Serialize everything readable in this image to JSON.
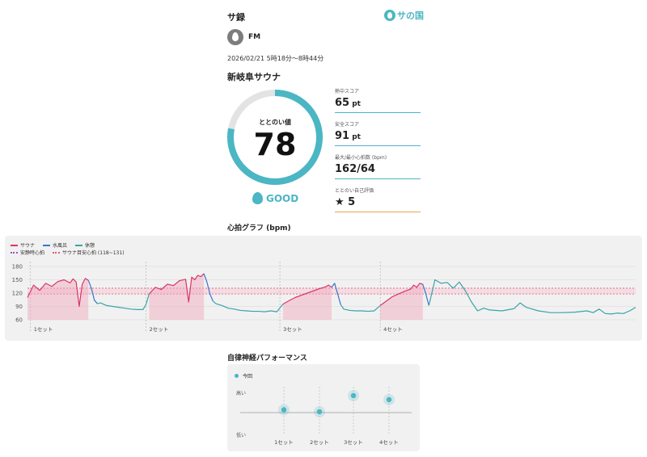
{
  "header": {
    "title": "サ録",
    "brand": "サの国"
  },
  "user": {
    "name": "FM",
    "icon": "drop-avatar-icon"
  },
  "session": {
    "datetime": "2026/02/21 5時18分〜8時44分",
    "facility": "新岐阜サウナ"
  },
  "score": {
    "label": "ととのい値",
    "value": "78",
    "max": 100,
    "grade": "GOOD",
    "grade_icon": "drop-icon"
  },
  "stats": [
    {
      "label": "熱中スコア",
      "value": "65",
      "unit": " pt"
    },
    {
      "label": "安全スコア",
      "value": "91",
      "unit": " pt"
    },
    {
      "label": "最大/最小心拍数 (bpm)",
      "value": "162/64",
      "unit": ""
    },
    {
      "label": "ととのい自己評価",
      "value": "★ 5",
      "unit": ""
    }
  ],
  "colors": {
    "accent": "#4bb6c4",
    "sauna": "#d9366b",
    "water": "#3b74c9",
    "rest": "#3aa3a8",
    "resting_line": "#9b4fd0",
    "target_band": "#e8577a",
    "self_eval_line": "#e8a74c"
  },
  "heart_chart": {
    "title": "心拍グラフ (bpm)",
    "legend": [
      {
        "label": "サウナ",
        "color": "#d9366b",
        "style": "solid"
      },
      {
        "label": "水風呂",
        "color": "#3b74c9",
        "style": "solid"
      },
      {
        "label": "休憩",
        "color": "#3aa3a8",
        "style": "solid"
      },
      {
        "label": "安静時心拍",
        "color": "#9b4fd0",
        "style": "dotted"
      },
      {
        "label": "サウナ目安心拍 (118~131)",
        "color": "#e8577a",
        "style": "dotted"
      }
    ],
    "sets": [
      "1セット",
      "2セット",
      "3セット",
      "4セット"
    ]
  },
  "chart_data": {
    "type": "line",
    "ylim": [
      60,
      180
    ],
    "yticks": [
      180,
      150,
      120,
      90,
      60
    ],
    "xlim": [
      0,
      100
    ],
    "target_range": [
      118,
      131
    ],
    "resting": 124,
    "set_markers": [
      {
        "label": "1セット",
        "x": 0.5
      },
      {
        "label": "2セット",
        "x": 19.5
      },
      {
        "label": "3セット",
        "x": 41.5
      },
      {
        "label": "4セット",
        "x": 58
      }
    ],
    "series": [
      {
        "name": "サウナ",
        "color": "#d9366b",
        "segments": [
          [
            [
              0,
              110
            ],
            [
              1,
              138
            ],
            [
              2,
              126
            ],
            [
              3,
              142
            ],
            [
              4,
              135
            ],
            [
              5,
              146
            ],
            [
              6,
              150
            ],
            [
              7,
              143
            ],
            [
              7.5,
              152
            ],
            [
              8,
              145
            ],
            [
              8.5,
              90
            ],
            [
              9,
              140
            ],
            [
              9.5,
              153
            ],
            [
              10,
              149
            ]
          ],
          [
            [
              20,
              118
            ],
            [
              21,
              133
            ],
            [
              22,
              128
            ],
            [
              23,
              140
            ],
            [
              24,
              137
            ],
            [
              25,
              148
            ],
            [
              26,
              151
            ],
            [
              26.5,
              100
            ],
            [
              27,
              156
            ],
            [
              27.5,
              150
            ],
            [
              28,
              160
            ],
            [
              28.5,
              157
            ],
            [
              29,
              164
            ]
          ],
          [
            [
              42,
              95
            ],
            [
              43,
              103
            ],
            [
              44,
              110
            ],
            [
              45,
              115
            ],
            [
              46,
              120
            ],
            [
              47,
              125
            ],
            [
              48,
              130
            ],
            [
              49,
              134
            ],
            [
              49.5,
              138
            ],
            [
              50,
              133
            ]
          ],
          [
            [
              58,
              92
            ],
            [
              59,
              102
            ],
            [
              60,
              112
            ],
            [
              61,
              118
            ],
            [
              62,
              124
            ],
            [
              63,
              129
            ],
            [
              63.5,
              138
            ],
            [
              64,
              133
            ],
            [
              64.5,
              142
            ],
            [
              65,
              140
            ]
          ]
        ]
      },
      {
        "name": "水風呂",
        "color": "#3b74c9",
        "segments": [
          [
            [
              10,
              149
            ],
            [
              10.5,
              131
            ],
            [
              11,
              104
            ],
            [
              11.5,
              96
            ]
          ],
          [
            [
              29,
              164
            ],
            [
              29.5,
              145
            ],
            [
              30,
              118
            ],
            [
              30.5,
              102
            ]
          ],
          [
            [
              50,
              133
            ],
            [
              50.5,
              142
            ],
            [
              51,
              118
            ],
            [
              51.5,
              94
            ]
          ],
          [
            [
              65,
              140
            ],
            [
              65.5,
              118
            ],
            [
              66,
              92
            ]
          ]
        ]
      },
      {
        "name": "休憩",
        "color": "#3aa3a8",
        "segments": [
          [
            [
              11.5,
              96
            ],
            [
              12,
              98
            ],
            [
              13,
              92
            ],
            [
              14,
              90
            ],
            [
              15,
              88
            ],
            [
              16,
              86
            ],
            [
              17,
              84
            ],
            [
              18,
              83
            ],
            [
              19,
              83
            ],
            [
              19.5,
              95
            ],
            [
              20,
              118
            ]
          ],
          [
            [
              30.5,
              102
            ],
            [
              31,
              96
            ],
            [
              32,
              92
            ],
            [
              33,
              86
            ],
            [
              34,
              84
            ],
            [
              35,
              81
            ],
            [
              36,
              80
            ],
            [
              37,
              79
            ],
            [
              38,
              79
            ],
            [
              39,
              78
            ],
            [
              40,
              80
            ],
            [
              41,
              78
            ],
            [
              42,
              95
            ]
          ],
          [
            [
              51.5,
              94
            ],
            [
              52,
              84
            ],
            [
              53,
              81
            ],
            [
              54,
              80
            ],
            [
              55,
              80
            ],
            [
              56,
              79
            ],
            [
              57,
              80
            ],
            [
              58,
              92
            ]
          ],
          [
            [
              66,
              92
            ],
            [
              67,
              150
            ],
            [
              68,
              142
            ],
            [
              69,
              144
            ],
            [
              70,
              131
            ],
            [
              71,
              145
            ],
            [
              72,
              125
            ],
            [
              73,
              100
            ],
            [
              74,
              80
            ],
            [
              75,
              86
            ],
            [
              76,
              82
            ],
            [
              78,
              80
            ],
            [
              80,
              85
            ],
            [
              81,
              98
            ],
            [
              82,
              88
            ],
            [
              84,
              80
            ],
            [
              86,
              76
            ],
            [
              88,
              76
            ],
            [
              90,
              77
            ],
            [
              92,
              80
            ],
            [
              93,
              76
            ],
            [
              94,
              84
            ],
            [
              95,
              74
            ],
            [
              96,
              73
            ],
            [
              97,
              75
            ],
            [
              98,
              74
            ],
            [
              99,
              80
            ],
            [
              100,
              88
            ]
          ]
        ]
      }
    ]
  },
  "ans_chart": {
    "title": "自律神経パフォーマンス",
    "legend": "今回",
    "high_label": "高い",
    "low_label": "低い",
    "categories": [
      "1セット",
      "2セット",
      "3セット",
      "4セット"
    ],
    "values": [
      0.55,
      0.5,
      0.9,
      0.8
    ]
  }
}
